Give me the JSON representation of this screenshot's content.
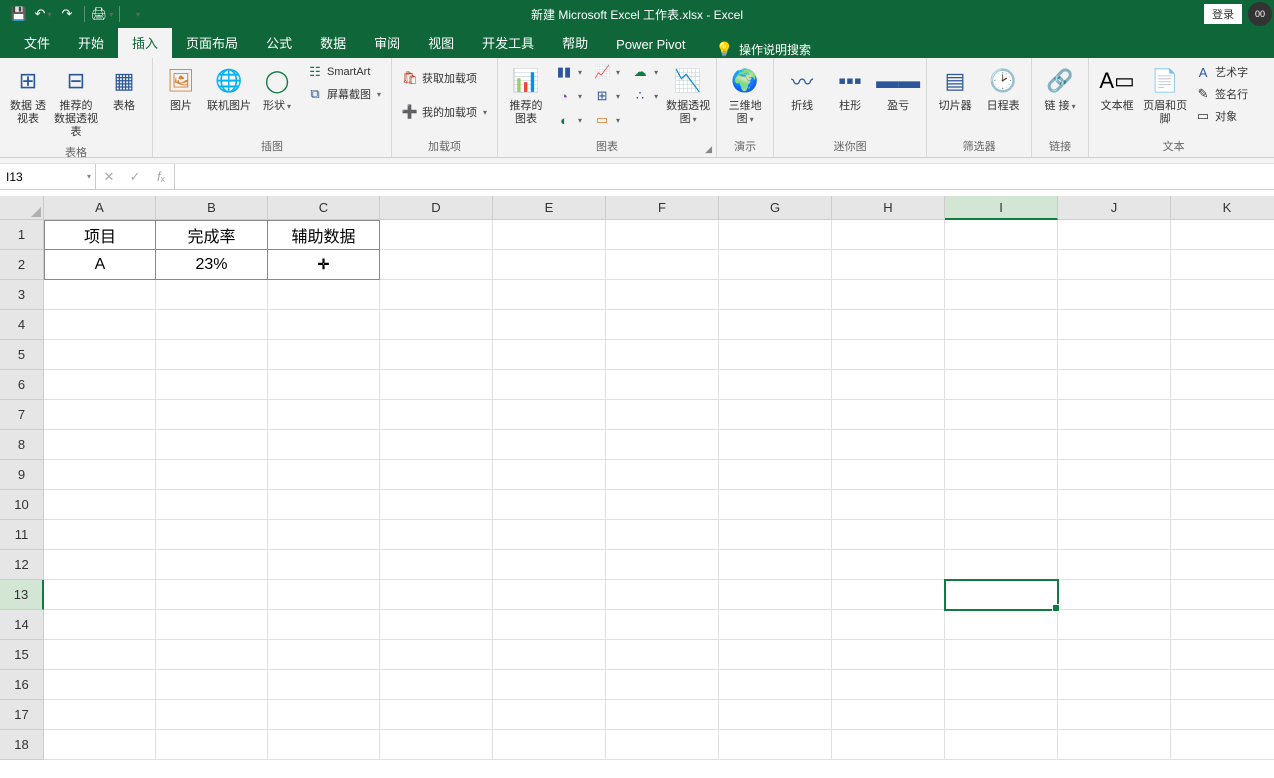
{
  "title": "新建 Microsoft Excel 工作表.xlsx  -  Excel",
  "login": "登录",
  "avatar_badge": "00",
  "tabs": [
    "文件",
    "开始",
    "插入",
    "页面布局",
    "公式",
    "数据",
    "审阅",
    "视图",
    "开发工具",
    "帮助",
    "Power Pivot"
  ],
  "active_tab_index": 2,
  "search_placeholder": "操作说明搜索",
  "ribbon": {
    "tables": {
      "pivot": "数据\n透视表",
      "rec": "推荐的\n数据透视表",
      "table": "表格",
      "label": "表格"
    },
    "illus": {
      "pic": "图片",
      "online": "联机图片",
      "shapes": "形状",
      "smartart": "SmartArt",
      "screenshot": "屏幕截图",
      "label": "插图"
    },
    "addins": {
      "get": "获取加载项",
      "my": "我的加载项",
      "label": "加载项"
    },
    "charts": {
      "rec": "推荐的\n图表",
      "pivotchart": "数据透视图",
      "map": "三维地\n图",
      "label": "图表",
      "demo_label": "演示"
    },
    "spark": {
      "line": "折线",
      "col": "柱形",
      "winloss": "盈亏",
      "label": "迷你图"
    },
    "filter": {
      "slicer": "切片器",
      "timeline": "日程表",
      "label": "筛选器"
    },
    "link": {
      "link": "链\n接",
      "label": "链接"
    },
    "text": {
      "textbox": "文本框",
      "header": "页眉和页脚",
      "wordart": "艺术字",
      "sig": "签名行",
      "obj": "对象",
      "label": "文本"
    }
  },
  "namebox": "I13",
  "formula": "",
  "columns": [
    "A",
    "B",
    "C",
    "D",
    "E",
    "F",
    "G",
    "H",
    "I",
    "J",
    "K"
  ],
  "rows": 18,
  "selected": {
    "col": 8,
    "row": 12
  },
  "data": {
    "A1": "项目",
    "B1": "完成率",
    "C1": "辅助数据",
    "A2": "A",
    "B2": "23%"
  },
  "cursor_at": "C2"
}
